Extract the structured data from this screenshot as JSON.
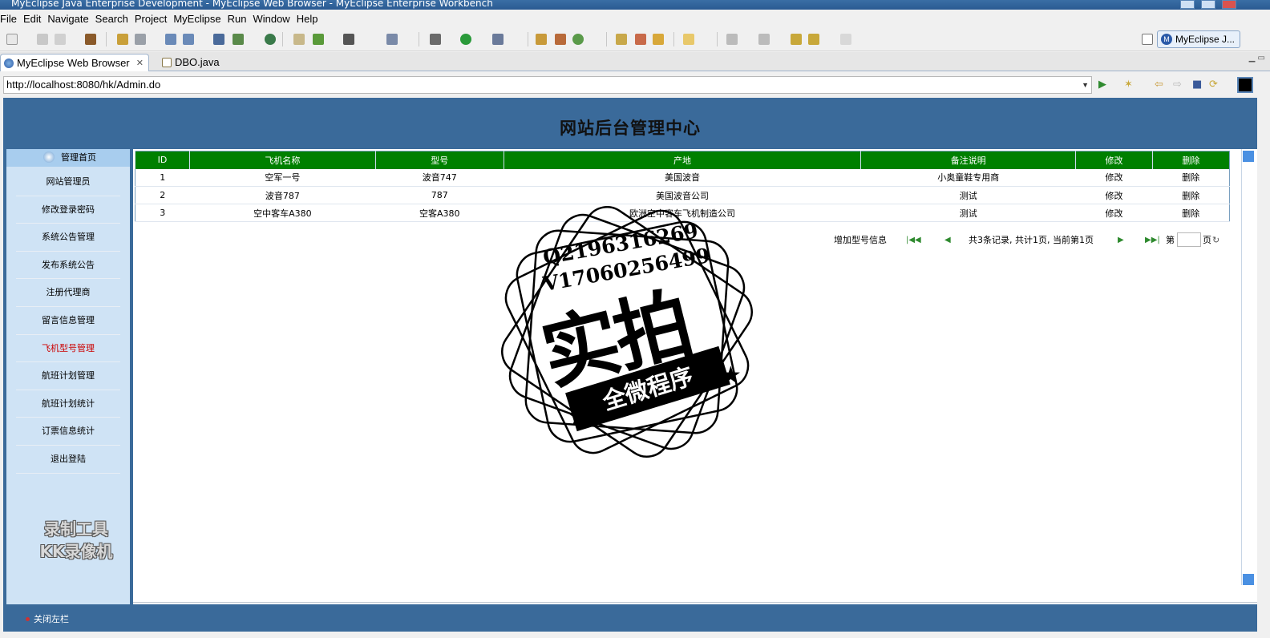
{
  "window": {
    "title": "MyEclipse Java Enterprise Development - MyEclipse Web Browser - MyEclipse Enterprise Workbench"
  },
  "menu": [
    "File",
    "Edit",
    "Navigate",
    "Search",
    "Project",
    "MyEclipse",
    "Run",
    "Window",
    "Help"
  ],
  "perspective": {
    "label": "MyEclipse J..."
  },
  "tabs": [
    {
      "label": "MyEclipse Web Browser",
      "active": true
    },
    {
      "label": "DBO.java",
      "active": false
    }
  ],
  "browser": {
    "url": "http://localhost:8080/hk/Admin.do"
  },
  "site": {
    "title": "网站后台管理中心",
    "home_label": "管理首页",
    "nav": [
      {
        "label": "网站管理员"
      },
      {
        "label": "修改登录密码"
      },
      {
        "label": "系统公告管理"
      },
      {
        "label": "发布系统公告"
      },
      {
        "label": "注册代理商"
      },
      {
        "label": "留言信息管理"
      },
      {
        "label": "飞机型号管理",
        "current": true
      },
      {
        "label": "航班计划管理"
      },
      {
        "label": "航班计划统计"
      },
      {
        "label": "订票信息统计"
      },
      {
        "label": "退出登陆"
      }
    ],
    "close_sidebar": "关闭左栏",
    "table": {
      "columns": [
        "ID",
        "飞机名称",
        "型号",
        "产地",
        "备注说明",
        "修改",
        "删除"
      ],
      "rows": [
        [
          "1",
          "空军一号",
          "波音747",
          "美国波音",
          "小奥童鞋专用商",
          "修改",
          "删除"
        ],
        [
          "2",
          "波音787",
          "787",
          "美国波音公司",
          "测试",
          "修改",
          "删除"
        ],
        [
          "3",
          "空中客车A380",
          "空客A380",
          "欧洲空中客车飞机制造公司",
          "测试",
          "修改",
          "删除"
        ]
      ]
    },
    "pager": {
      "add": "增加型号信息",
      "summary": "共3条记录, 共计1页, 当前第1页",
      "goto_prefix": "第",
      "goto_suffix": "页"
    }
  },
  "overlay": {
    "qq": "Q2196316269",
    "wx": "V17060256499",
    "main": "实拍",
    "ribbon": "全微程序",
    "recorder_line1": "录制工具",
    "recorder_line2": "KK录像机"
  },
  "colors": {
    "header_bg": "#3a6a9a",
    "table_header_bg": "#008000",
    "sidebar_bg": "#cfe3f5",
    "current_nav": "#cc0000"
  }
}
